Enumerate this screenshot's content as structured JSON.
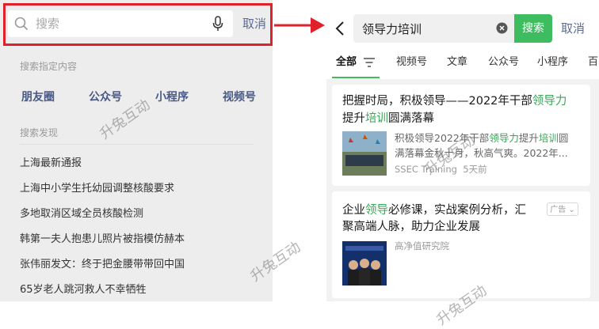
{
  "left_panel": {
    "search_placeholder": "搜索",
    "cancel_label": "取消",
    "specified_title": "搜索指定内容",
    "specified_items": [
      "朋友圈",
      "公众号",
      "小程序",
      "视频号"
    ],
    "discover_title": "搜索发现",
    "discover_items": [
      "上海最新通报",
      "上海中小学生托幼园调整核酸要求",
      "多地取消区域全员核酸检测",
      "韩第一夫人抱患儿照片被指模仿赫本",
      "张伟丽发文：终于把金腰带带回中国",
      "65岁老人跳河救人不幸牺牲"
    ]
  },
  "right_panel": {
    "query": "领导力培训",
    "search_button": "搜索",
    "cancel_label": "取消",
    "tabs": [
      "全部",
      "视频号",
      "文章",
      "公众号",
      "小程序",
      "百"
    ],
    "results": [
      {
        "title_parts": [
          "把握时局，积极领导——2022年干部",
          "领导力",
          "提升",
          "培训",
          "圆满落幕"
        ],
        "title_line1_a": "把握时局，积极领导——2022年干部",
        "title_line1_hl": "领导力",
        "title_line2_a": "提升",
        "title_line2_hl": "培训",
        "title_line2_b": "圆满落幕",
        "excerpt_line1_a": "积极领导2022年干部",
        "excerpt_line1_hl1": "领导力",
        "excerpt_line1_b": "提升",
        "excerpt_line1_hl2": "培训",
        "excerpt_line1_c": "圆",
        "excerpt_line2": "满落幕金秋十月，秋高气爽。2022年...",
        "source": "SSEC Training",
        "time": "5天前"
      },
      {
        "title_line1_a": "企业",
        "title_line1_hl": "领导",
        "title_line1_b": "必修课，实战案例分析，汇",
        "title_line2": "聚高端人脉，助力企业发展",
        "ad_label": "广告",
        "source": "高净值研究院"
      }
    ]
  },
  "watermark": "升兔互动",
  "colors": {
    "accent_green": "#3dbd5f",
    "highlight_red": "#e0202b",
    "link_blue": "#5b6b92"
  }
}
